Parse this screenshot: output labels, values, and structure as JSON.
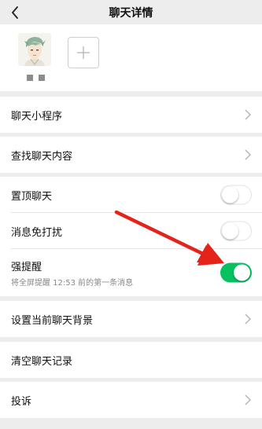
{
  "navbar": {
    "title": "聊天详情",
    "back_icon": "chevron-left-icon"
  },
  "members": {
    "avatar_icon": "anime-avatar",
    "name_masked": "■ ■",
    "add_icon": "plus-icon"
  },
  "cells": {
    "mini_program": "聊天小程序",
    "search_content": "查找聊天内容",
    "pin_chat": "置顶聊天",
    "mute": "消息免打扰",
    "strong_remind": "强提醒",
    "strong_remind_sub": "将全屏提醒 12:53 前的第一条消息",
    "set_background": "设置当前聊天背景",
    "clear_history": "清空聊天记录",
    "complain": "投诉"
  },
  "switches": {
    "pin_chat": false,
    "mute": false,
    "strong_remind": true
  },
  "colors": {
    "switch_on": "#07c160",
    "annotation_arrow": "#e5231b",
    "background": "#ededed"
  }
}
